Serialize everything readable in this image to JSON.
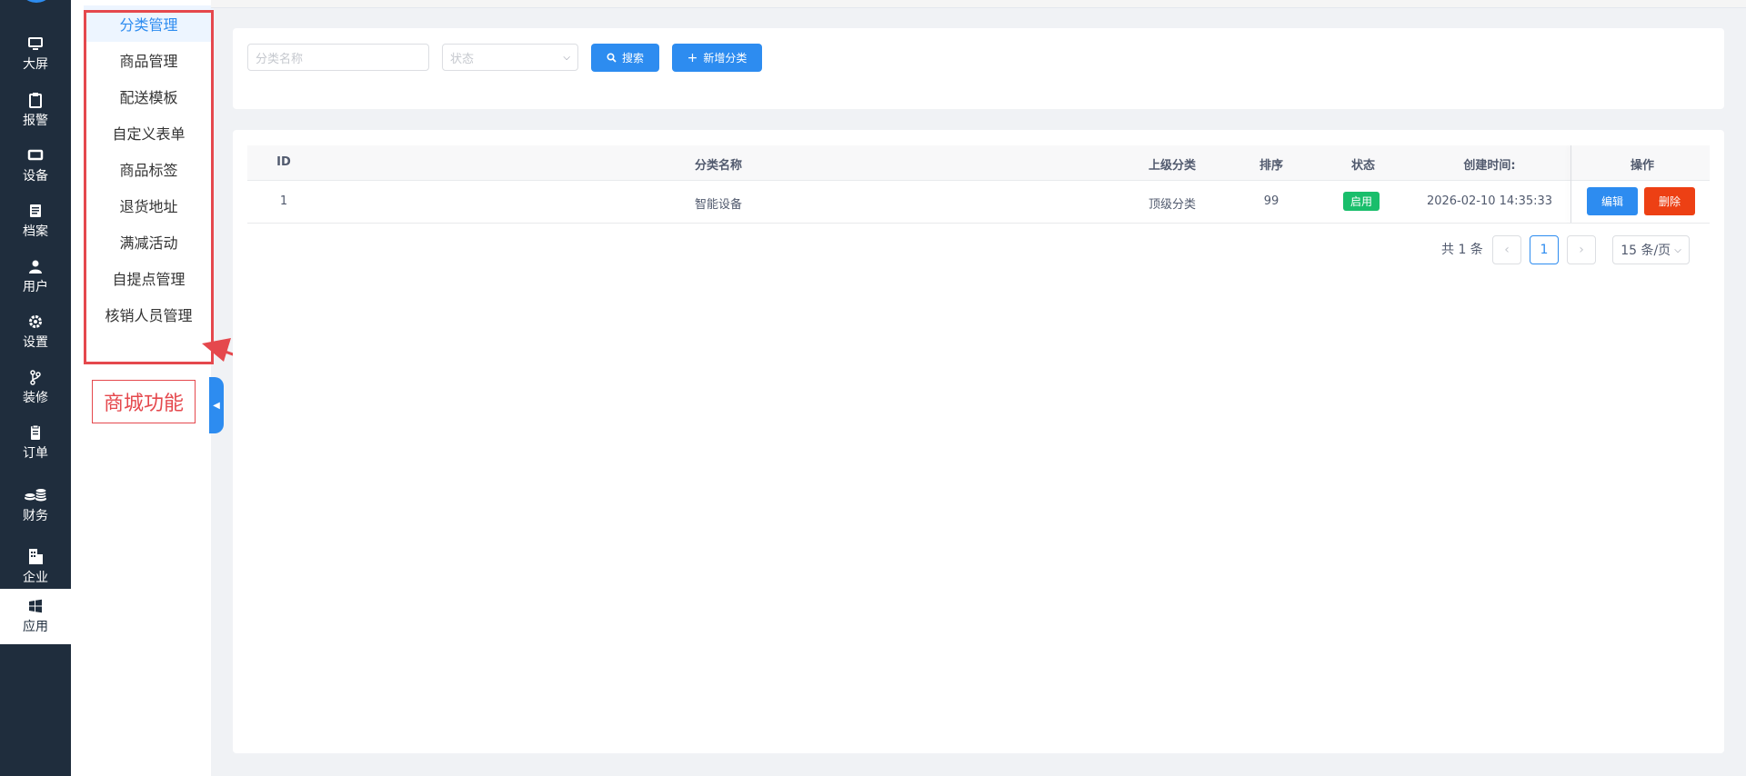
{
  "rail": {
    "items": [
      {
        "label": "大屏",
        "icon": "monitor-icon"
      },
      {
        "label": "报警",
        "icon": "clipboard-icon"
      },
      {
        "label": "设备",
        "icon": "device-icon"
      },
      {
        "label": "档案",
        "icon": "document-icon"
      },
      {
        "label": "用户",
        "icon": "user-icon"
      },
      {
        "label": "设置",
        "icon": "gear-icon"
      },
      {
        "label": "装修",
        "icon": "branch-icon"
      },
      {
        "label": "订单",
        "icon": "order-icon"
      },
      {
        "label": "财务",
        "icon": "coins-icon"
      },
      {
        "label": "企业",
        "icon": "building-icon"
      },
      {
        "label": "应用",
        "icon": "windows-icon"
      }
    ],
    "active": "应用"
  },
  "submenu": {
    "items": [
      "分类管理",
      "商品管理",
      "配送模板",
      "自定义表单",
      "商品标签",
      "退货地址",
      "满减活动",
      "自提点管理",
      "核销人员管理"
    ],
    "active": "分类管理"
  },
  "annotation": {
    "label": "商城功能",
    "color": "#e5484d"
  },
  "search": {
    "name_placeholder": "分类名称",
    "status_placeholder": "状态",
    "search_label": "搜索",
    "add_label": "新增分类"
  },
  "table": {
    "headers": {
      "id": "ID",
      "name": "分类名称",
      "parent": "上级分类",
      "sort": "排序",
      "status": "状态",
      "created": "创建时间:",
      "actions": "操作"
    },
    "rows": [
      {
        "id": "1",
        "name": "智能设备",
        "parent": "顶级分类",
        "sort": "99",
        "status": "启用",
        "created": "2026-02-10 14:35:33",
        "edit": "编辑",
        "delete": "删除"
      }
    ]
  },
  "pagination": {
    "total": "共 1 条",
    "current": "1",
    "page_size": "15 条/页"
  },
  "colors": {
    "primary": "#2d8cf0",
    "success": "#19be6b",
    "danger": "#ed4014",
    "rail_bg": "#1f2d3d"
  }
}
